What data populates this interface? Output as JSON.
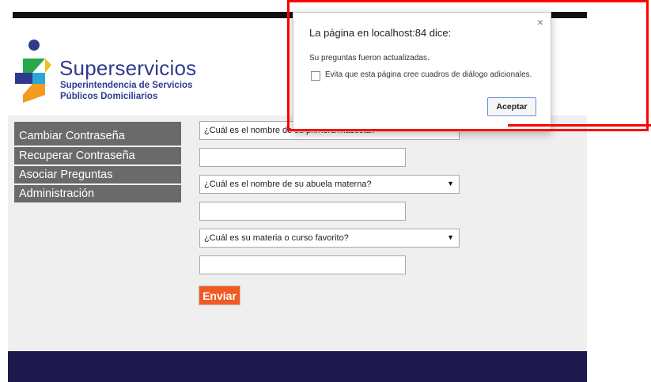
{
  "logo": {
    "brand": "Superservicios",
    "subtitle_line1": "Superintendencia de Servicios",
    "subtitle_line2": "Públicos Domiciliarios"
  },
  "menu": {
    "items": [
      {
        "label": "Cambiar Contraseña"
      },
      {
        "label": "Recuperar Contraseña"
      },
      {
        "label": "Asociar Preguntas"
      },
      {
        "label": "Administración"
      }
    ]
  },
  "form": {
    "question1": "¿Cuál es el nombre de su primera mascota?",
    "question2": "¿Cuál es el nombre de su abuela materna?",
    "question3": "¿Cuál es su materia o curso favorito?",
    "answer1": "",
    "answer2": "",
    "answer3": "",
    "submit_label": "Enviar"
  },
  "dialog": {
    "title": "La página en localhost:84 dice:",
    "message": "Su preguntas fueron actualizadas.",
    "checkbox_label": "Evita que esta página cree cuadros de diálogo adicionales.",
    "ok_label": "Aceptar",
    "close_glyph": "×"
  },
  "colors": {
    "brand": "#2f3a8f",
    "menu_bg": "#6a6a6a",
    "submit_bg": "#f05a23",
    "footer_bg": "#1e1a4e",
    "highlight": "#ff0000"
  }
}
